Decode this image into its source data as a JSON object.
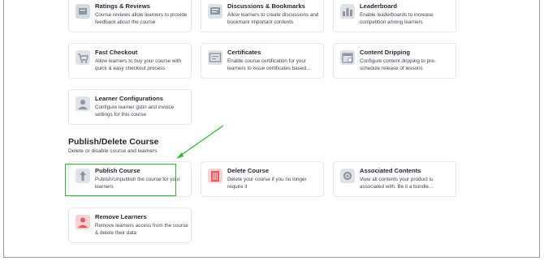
{
  "cards_top": [
    {
      "title": "Ratings & Reviews",
      "desc": "Course reviews allow learners to provide feedback about the course",
      "icon": "ratings-icon"
    },
    {
      "title": "Discussions & Bookmarks",
      "desc": "Allow learners to create discussions and bookmark important contents",
      "icon": "discussions-icon"
    },
    {
      "title": "Leaderboard",
      "desc": "Enable leaderboards to increase competition among learners",
      "icon": "leaderboard-icon"
    },
    {
      "title": "Fast Checkout",
      "desc": "Allow learners to buy your course with quick & easy checkout process",
      "icon": "checkout-icon"
    },
    {
      "title": "Certificates",
      "desc": "Enable course certification for your learners to issue certificates based...",
      "icon": "certificate-icon"
    },
    {
      "title": "Content Dripping",
      "desc": "Configure content dripping to pre-schedule release of lessons",
      "icon": "dripping-icon"
    },
    {
      "title": "Learner Configurations",
      "desc": "Configure learner gstin and invoice settings for this course",
      "icon": "learner-icon"
    }
  ],
  "section": {
    "title": "Publish/Delete Course",
    "subtitle": "Delete or disable course and learners"
  },
  "cards_bottom": [
    {
      "title": "Publish Course",
      "desc": "Publish/Unpublish the course for your learners",
      "icon": "publish-icon"
    },
    {
      "title": "Delete Course",
      "desc": "Delete your course if you no longer require it",
      "icon": "delete-icon"
    },
    {
      "title": "Associated Contents",
      "desc": "View all contents your product is associated with. Be it a bundle...",
      "icon": "associated-icon"
    },
    {
      "title": "Remove Learners",
      "desc": "Remove learners access from the course & delete their data",
      "icon": "remove-learners-icon"
    }
  ],
  "colors": {
    "highlight": "#2fb52f",
    "delete_icon": "#e65a5a",
    "remove_icon": "#e25c5c"
  }
}
